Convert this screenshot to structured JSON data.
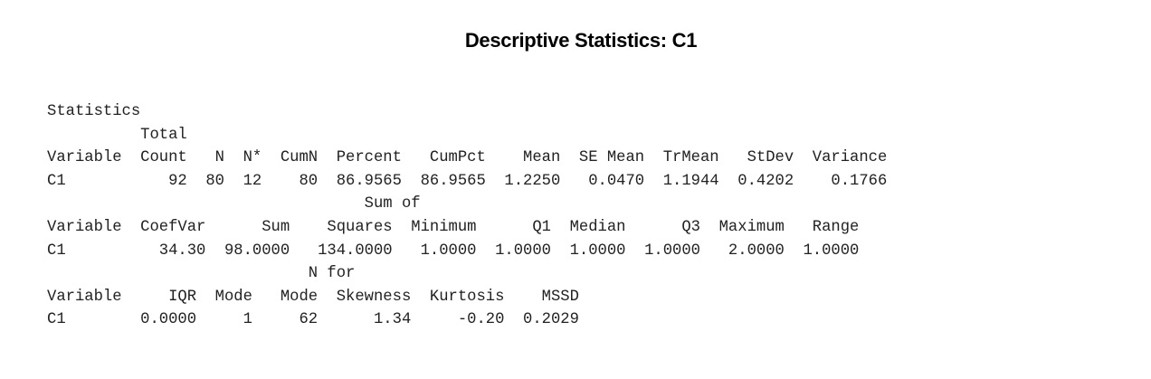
{
  "title": "Descriptive Statistics: C1",
  "section_label": "Statistics",
  "lines": [
    "          Total",
    "Variable  Count   N  N*  CumN  Percent   CumPct    Mean  SE Mean  TrMean   StDev  Variance",
    "C1           92  80  12    80  86.9565  86.9565  1.2250   0.0470  1.1944  0.4202    0.1766",
    "                                  Sum of",
    "Variable  CoefVar      Sum    Squares  Minimum      Q1  Median      Q3  Maximum   Range",
    "C1          34.30  98.0000   134.0000   1.0000  1.0000  1.0000  1.0000   2.0000  1.0000",
    "                            N for",
    "Variable     IQR  Mode   Mode  Skewness  Kurtosis    MSSD",
    "C1        0.0000     1     62      1.34     -0.20  0.2029"
  ],
  "table_1": {
    "headers": [
      "Variable",
      "Total Count",
      "N",
      "N*",
      "CumN",
      "Percent",
      "CumPct",
      "Mean",
      "SE Mean",
      "TrMean",
      "StDev",
      "Variance"
    ],
    "rows": [
      [
        "C1",
        "92",
        "80",
        "12",
        "80",
        "86.9565",
        "86.9565",
        "1.2250",
        "0.0470",
        "1.1944",
        "0.4202",
        "0.1766"
      ]
    ]
  },
  "table_2": {
    "headers": [
      "Variable",
      "CoefVar",
      "Sum",
      "Sum of Squares",
      "Minimum",
      "Q1",
      "Median",
      "Q3",
      "Maximum",
      "Range"
    ],
    "rows": [
      [
        "C1",
        "34.30",
        "98.0000",
        "134.0000",
        "1.0000",
        "1.0000",
        "1.0000",
        "1.0000",
        "2.0000",
        "1.0000"
      ]
    ]
  },
  "table_3": {
    "headers": [
      "Variable",
      "IQR",
      "Mode",
      "N for Mode",
      "Skewness",
      "Kurtosis",
      "MSSD"
    ],
    "rows": [
      [
        "C1",
        "0.0000",
        "1",
        "62",
        "1.34",
        "-0.20",
        "0.2029"
      ]
    ]
  }
}
